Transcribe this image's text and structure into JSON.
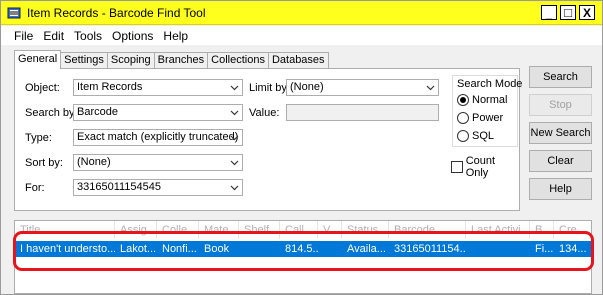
{
  "window": {
    "title": "Item Records - Barcode Find Tool",
    "icon": "app-icon",
    "controls": {
      "minimize": "_",
      "maximize": "□",
      "close": "X"
    }
  },
  "menu": [
    "File",
    "Edit",
    "Tools",
    "Options",
    "Help"
  ],
  "tabs": [
    "General",
    "Settings",
    "Scoping",
    "Branches",
    "Collections",
    "Databases"
  ],
  "form": {
    "object_label": "Object:",
    "object_value": "Item Records",
    "limit_label": "Limit by:",
    "limit_value": "(None)",
    "searchby_label": "Search by:",
    "searchby_value": "Barcode",
    "value_label": "Value:",
    "value_value": "",
    "type_label": "Type:",
    "type_value": "Exact match (explicitly truncated)",
    "sortby_label": "Sort by:",
    "sortby_value": "(None)",
    "for_label": "For:",
    "for_value": "33165011154545"
  },
  "search_mode": {
    "title": "Search Mode",
    "options": [
      "Normal",
      "Power",
      "SQL"
    ],
    "selected": "Normal"
  },
  "count_only_label": "Count Only",
  "buttons": {
    "search": "Search",
    "stop": "Stop",
    "new_search": "New Search",
    "clear": "Clear",
    "help": "Help"
  },
  "results": {
    "columns": [
      "Title",
      "Assig...",
      "Colle...",
      "Mate...",
      "Shelf...",
      "Call ...",
      "V...",
      "Status",
      "Barcode",
      "Last Activi...",
      "B...",
      "Cre..."
    ],
    "rows": [
      [
        "I haven't understo...",
        "Lakot...",
        "Nonfi...",
        "Book",
        "",
        "814.5...",
        "",
        "Availa...",
        "33165011154...",
        "",
        "Fi...",
        "134..."
      ]
    ]
  },
  "colors": {
    "titlebar": "#ffff1e",
    "selection": "#0078d7",
    "annotation": "#e8141c"
  }
}
